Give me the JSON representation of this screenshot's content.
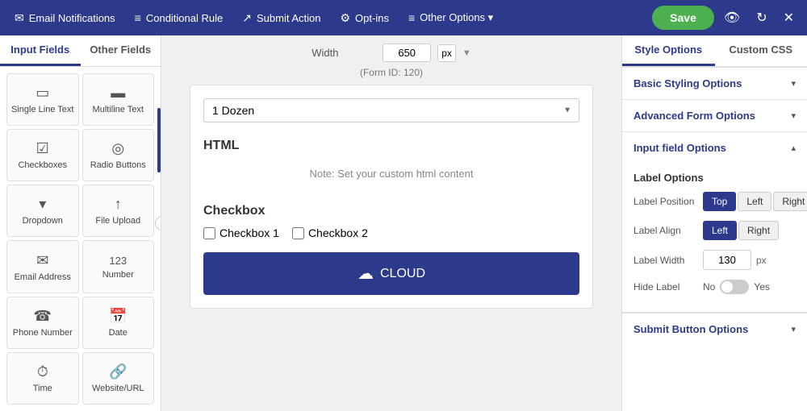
{
  "nav": {
    "items": [
      {
        "id": "email-notifications",
        "label": "Email Notifications",
        "icon": "✉"
      },
      {
        "id": "conditional-rule",
        "label": "Conditional Rule",
        "icon": "≡"
      },
      {
        "id": "submit-action",
        "label": "Submit Action",
        "icon": "↗"
      },
      {
        "id": "opt-ins",
        "label": "Opt-ins",
        "icon": "⚙"
      },
      {
        "id": "other-options",
        "label": "Other Options ▾",
        "icon": "≡"
      }
    ],
    "save_label": "Save"
  },
  "sidebar": {
    "tab_input": "Input Fields",
    "tab_other": "Other Fields",
    "fields": [
      {
        "id": "single-line",
        "label": "Single Line Text",
        "icon": "▭"
      },
      {
        "id": "multiline",
        "label": "Multiline Text",
        "icon": "▬"
      },
      {
        "id": "checkboxes",
        "label": "Checkboxes",
        "icon": "☑"
      },
      {
        "id": "radio",
        "label": "Radio Buttons",
        "icon": "◎"
      },
      {
        "id": "dropdown",
        "label": "Dropdown",
        "icon": "▾"
      },
      {
        "id": "file-upload",
        "label": "File Upload",
        "icon": "↑"
      },
      {
        "id": "email",
        "label": "Email Address",
        "icon": "✉"
      },
      {
        "id": "number",
        "label": "Number",
        "icon": "123"
      },
      {
        "id": "phone",
        "label": "Phone Number",
        "icon": "☎"
      },
      {
        "id": "date",
        "label": "Date",
        "icon": "📅"
      },
      {
        "id": "time",
        "label": "Time",
        "icon": "⏱"
      },
      {
        "id": "website",
        "label": "Website/URL",
        "icon": "🔗"
      }
    ]
  },
  "form": {
    "width_label": "Width",
    "width_value": "650",
    "width_unit": "px",
    "form_id_label": "(Form ID: 120)",
    "dropdown_value": "1 Dozen",
    "html_section_title": "HTML",
    "html_note": "Note: Set your custom html content",
    "checkbox_section_title": "Checkbox",
    "checkbox_items": [
      "Checkbox 1",
      "Checkbox 2"
    ],
    "submit_label": "CLOUD"
  },
  "right_panel": {
    "tab_style": "Style Options",
    "tab_css": "Custom CSS",
    "sections": [
      {
        "id": "basic-styling",
        "label": "Basic Styling Options",
        "expanded": false
      },
      {
        "id": "advanced-form",
        "label": "Advanced Form Options",
        "expanded": false
      },
      {
        "id": "input-field",
        "label": "Input field Options",
        "expanded": true
      }
    ],
    "label_options": {
      "title": "Label Options",
      "position_label": "Label Position",
      "position_buttons": [
        "Top",
        "Left",
        "Right"
      ],
      "position_active": "Top",
      "align_label": "Label Align",
      "align_buttons": [
        "Left",
        "Right"
      ],
      "align_active": "Left",
      "width_label": "Label Width",
      "width_value": "130",
      "width_unit": "px",
      "hide_label": "Hide Label",
      "hide_no": "No",
      "hide_yes": "Yes"
    },
    "submit_section": {
      "label": "Submit Button Options",
      "expanded": false
    }
  }
}
